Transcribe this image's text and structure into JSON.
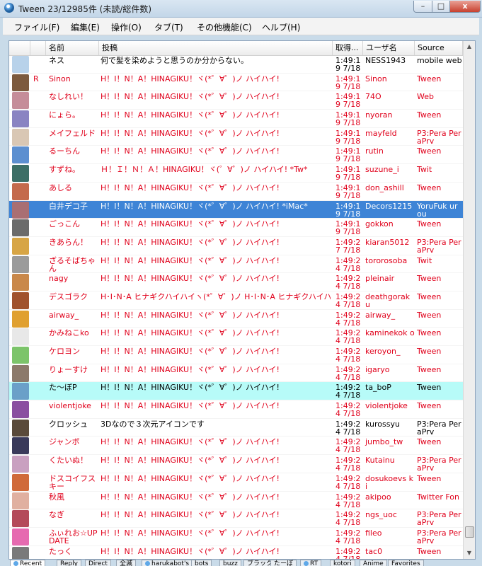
{
  "window": {
    "title": "Tween  23/12985件 (未読/総件数)",
    "min_label": "–",
    "max_label": "□",
    "close_label": "x"
  },
  "menu": [
    "ファイル(F)",
    "編集(E)",
    "操作(O)",
    "タブ(T)",
    "その他機能(C)",
    "ヘルプ(H)"
  ],
  "columns": {
    "name": "名前",
    "text": "投稿",
    "time": "取得...",
    "user": "ユーザ名",
    "source": "Source"
  },
  "rows": [
    {
      "mark": "",
      "name": "ネス",
      "text": "何で髪を染めようと思うのか分からない。",
      "time": "1:49:19 7/18",
      "user": "NESS1943",
      "source": "mobile web",
      "style": "black",
      "avatar": "#b8d2ea"
    },
    {
      "mark": "R",
      "name": "Sinon",
      "text": "H！I！N！A！HINAGIKU！ヾ(*゜∀゜)ノ ハイハイ!",
      "time": "1:49:19 7/18",
      "user": "Sinon",
      "source": "Tween",
      "style": "red",
      "avatar": "#7c5a3e"
    },
    {
      "mark": "",
      "name": "なしれい！",
      "text": "H！I！N！A！HINAGIKU！ヾ(*゜∀゜)ノ ハイハイ!",
      "time": "1:49:19 7/18",
      "user": "74O",
      "source": "Web",
      "style": "red",
      "avatar": "#c58d99"
    },
    {
      "mark": "",
      "name": "にょら。",
      "text": "H！I！N！A！HINAGIKU！ヾ(*゜∀゜)ノ ハイハイ!",
      "time": "1:49:19 7/18",
      "user": "nyoran",
      "source": "Tween",
      "style": "red",
      "avatar": "#8a84c2"
    },
    {
      "mark": "",
      "name": "メイフェルド",
      "text": "H！I！N！A！HINAGIKU！ヾ(*゜∀゜)ノ ハイハイ!",
      "time": "1:49:19 7/18",
      "user": "mayfeld",
      "source": "P3:Pera PeraPrv",
      "style": "red",
      "avatar": "#d9c7b4"
    },
    {
      "mark": "",
      "name": "るーちん",
      "text": "H！I！N！A！HINAGIKU！ヾ(*゜∀゜)ノ ハイハイ!",
      "time": "1:49:19 7/18",
      "user": "rutin",
      "source": "Tween",
      "style": "red",
      "avatar": "#5c8fd0"
    },
    {
      "mark": "",
      "name": "すずね。",
      "text": "Ｈ！Ｉ！Ｎ！Ａ！HINAGIKU！ヾ(゜∀゜)ノ ハイハイ! *Tw*",
      "time": "1:49:19 7/18",
      "user": "suzune_i",
      "source": "Twit",
      "style": "red",
      "avatar": "#3c6e66"
    },
    {
      "mark": "",
      "name": "あしる",
      "text": "H！I！N！A！HINAGIKU！ヾ(*゜∀゜)ノ ハイハイ!",
      "time": "1:49:19 7/18",
      "user": "don_ashill",
      "source": "Tween",
      "style": "red",
      "avatar": "#c46a4c"
    },
    {
      "mark": "",
      "name": "白井デコ子",
      "text": "H！I！N！A！HINAGIKU！ヾ(*゜∀゜)ノ ハイハイ! *iMac*",
      "time": "1:49:19 7/18",
      "user": "Decors1215",
      "source": "YoruFuk urou",
      "style": "selected",
      "avatar": "#a96f73"
    },
    {
      "mark": "",
      "name": "ごっこん",
      "text": "H！I！N！A！HINAGIKU！ヾ(*゜∀゜)ノ ハイハイ!",
      "time": "1:49:19 7/18",
      "user": "gokkon",
      "source": "Tween",
      "style": "red",
      "avatar": "#6b6b6b"
    },
    {
      "mark": "",
      "name": "きあらん！",
      "text": "H！I！N！A！HINAGIKU！ヾ(*゜∀゜)ノ ハイハイ!",
      "time": "1:49:27 7/18",
      "user": "kiaran5012",
      "source": "P3:Pera PeraPrv",
      "style": "red",
      "avatar": "#d7a545"
    },
    {
      "mark": "",
      "name": "ざるそばちゃん",
      "text": "H！I！N！A！HINAGIKU！ヾ(*゜∀゜)ノ ハイハイ!",
      "time": "1:49:24 7/18",
      "user": "tororosoba",
      "source": "Twit",
      "style": "red",
      "avatar": "#9b9b9b"
    },
    {
      "mark": "",
      "name": "nagy",
      "text": "H！I！N！A！HINAGIKU！ヾ(*゜∀゜)ノ ハイハイ!",
      "time": "1:49:24 7/18",
      "user": "pleinair",
      "source": "Tween",
      "style": "red",
      "avatar": "#c9884a"
    },
    {
      "mark": "",
      "name": "デスゴラク",
      "text": "H･I･N･A ヒナギクハイハイヽ(*゜∀゜)ノ H･I･N･A ヒナギクハイハイヽ(*゜∀゜)ノ",
      "time": "1:49:24 7/18",
      "user": "deathgorak u",
      "source": "Tween",
      "style": "red",
      "avatar": "#a0522d"
    },
    {
      "mark": "",
      "name": "airway_",
      "text": "H！I！N！A！HINAGIKU！ヾ(*゜∀゜)ノ ハイハイ!",
      "time": "1:49:24 7/18",
      "user": "airway_",
      "source": "Tween",
      "style": "red",
      "avatar": "#e0a030"
    },
    {
      "mark": "",
      "name": "かみねこko",
      "text": "H！I！N！A！HINAGIKU！ヾ(*゜∀゜)ノ ハイハイ!",
      "time": "1:49:24 7/18",
      "user": "kaminekok o",
      "source": "Tween",
      "style": "red",
      "avatar": "#e8e8e8"
    },
    {
      "mark": "",
      "name": "ケロヨン",
      "text": "H！I！N！A！HINAGIKU！ヾ(*゜∀゜)ノ ハイハイ!",
      "time": "1:49:24 7/18",
      "user": "keroyon_",
      "source": "Tween",
      "style": "red",
      "avatar": "#7cc46a"
    },
    {
      "mark": "",
      "name": "りょーすけ",
      "text": "H！I！N！A！HINAGIKU！ヾ(*゜∀゜)ノ ハイハイ!",
      "time": "1:49:24 7/18",
      "user": "igaryo",
      "source": "Tween",
      "style": "red",
      "avatar": "#8c7a6b"
    },
    {
      "mark": "",
      "name": "た〜ぼP",
      "text": "H！I！N！A！HINAGIKU！ヾ(*゜∀゜)ノ ハイハイ!",
      "time": "1:49:24 7/18",
      "user": "ta_boP",
      "source": "Tween",
      "style": "highlight",
      "avatar": "#6aa0c8"
    },
    {
      "mark": "",
      "name": "violentjoke",
      "text": "H！I！N！A！HINAGIKU！ヾ(*゜∀゜)ノ ハイハイ!",
      "time": "1:49:24 7/18",
      "user": "violentjoke",
      "source": "Tween",
      "style": "red",
      "avatar": "#8a4fa0"
    },
    {
      "mark": "",
      "name": "クロッシュ",
      "text": "3Dなので３次元アイコンです",
      "time": "1:49:24 7/18",
      "user": "kurossyu",
      "source": "P3:Pera PeraPrv",
      "style": "black",
      "avatar": "#5a4a3a"
    },
    {
      "mark": "",
      "name": "ジャンボ",
      "text": "H！I！N！A！HINAGIKU！ヾ(*゜∀゜)ノ ハイハイ!",
      "time": "1:49:24 7/18",
      "user": "jumbo_tw",
      "source": "Tween",
      "style": "red",
      "avatar": "#3a3a5a"
    },
    {
      "mark": "",
      "name": "くたいぬ！",
      "text": "H！I！N！A！HINAGIKU！ヾ(*゜∀゜)ノ ハイハイ!",
      "time": "1:49:24 7/18",
      "user": "Kutainu",
      "source": "P3:Pera PeraPrv",
      "style": "red",
      "avatar": "#c9a0c0"
    },
    {
      "mark": "",
      "name": "ドスコイフスキー",
      "text": "H！I！N！A！HINAGIKU！ヾ(*゜∀゜)ノ ハイハイ!",
      "time": "1:49:24 7/18",
      "user": "dosukoevs ki",
      "source": "Tween",
      "style": "red",
      "avatar": "#d06a3a"
    },
    {
      "mark": "",
      "name": "秋風",
      "text": "H！I！N！A！HINAGIKU！ヾ(*゜∀゜)ノ ハイハイ!",
      "time": "1:49:24 7/18",
      "user": "akipoo",
      "source": "Twitter Fon",
      "style": "red",
      "avatar": "#e0b0a0"
    },
    {
      "mark": "",
      "name": "なぎ",
      "text": "H！I！N！A！HINAGIKU！ヾ(*゜∀゜)ノ ハイハイ!",
      "time": "1:49:24 7/18",
      "user": "ngs_uoc",
      "source": "P3:Pera PeraPrv",
      "style": "red",
      "avatar": "#b44a5a"
    },
    {
      "mark": "",
      "name": "ふぃれお☆UPDATE",
      "text": "H！I！N！A！HINAGIKU！ヾ(*゜∀゜)ノ ハイハイ!",
      "time": "1:49:24 7/18",
      "user": "fileo",
      "source": "P3:Pera PeraPrv",
      "style": "red",
      "avatar": "#e66ab0"
    },
    {
      "mark": "",
      "name": "たっく",
      "text": "H！I！N！A！HINAGIKU！ヾ(*゜∀゜)ノ ハイハイ!",
      "time": "1:49:24 7/18",
      "user": "tac0",
      "source": "Tween",
      "style": "red",
      "avatar": "#7a7a7a"
    }
  ],
  "tabs": [
    "Recent",
    "Reply",
    "Direct",
    "全滅",
    "harukabot's",
    "bots",
    "buzz",
    "ブラック",
    "たーぼ",
    "RT",
    "kotori",
    "Anime",
    "Favorites"
  ]
}
